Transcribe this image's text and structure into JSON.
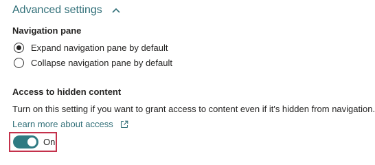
{
  "advanced_settings": {
    "title": "Advanced settings",
    "chevron_icon": "chevron-up-icon",
    "expanded": true
  },
  "navigation_pane": {
    "label": "Navigation pane",
    "options": [
      {
        "label": "Expand navigation pane by default",
        "selected": true
      },
      {
        "label": "Collapse navigation pane by default",
        "selected": false
      }
    ]
  },
  "hidden_content": {
    "label": "Access to hidden content",
    "description": "Turn on this setting if you want to grant access to content even if it's hidden from navigation.",
    "learn_more": "Learn more about access",
    "learn_more_icon": "external-link-icon",
    "toggle_state": "On",
    "toggle_on": true
  },
  "colors": {
    "accent": "#2f6e77",
    "toggle_on": "#2f7a82",
    "highlight_border": "#c4314b",
    "text": "#252423"
  }
}
